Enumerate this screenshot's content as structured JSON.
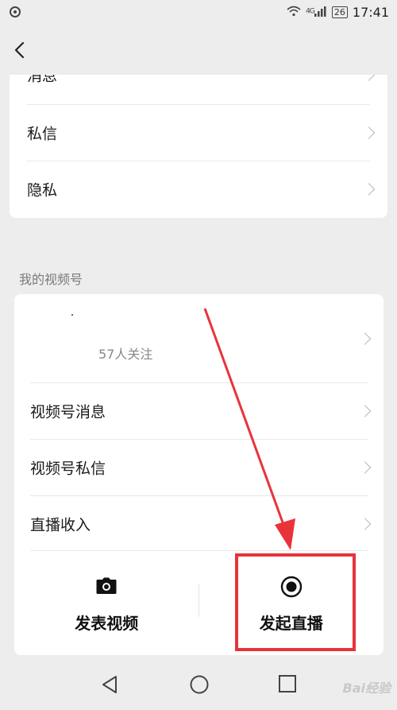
{
  "status_bar": {
    "network": "4G",
    "battery": "26",
    "time": "17:41"
  },
  "settings_list": [
    {
      "label": "消息"
    },
    {
      "label": "私信"
    },
    {
      "label": "隐私"
    }
  ],
  "channels": {
    "section_title": "我的视频号",
    "followers": "57人关注",
    "items": [
      {
        "label": "视频号消息"
      },
      {
        "label": "视频号私信"
      },
      {
        "label": "直播收入"
      }
    ],
    "actions": {
      "post_video": "发表视频",
      "start_live": "发起直播"
    }
  },
  "watermark": "Bai经验",
  "colors": {
    "annotation": "#e8333b",
    "background": "#ededed",
    "card": "#ffffff"
  }
}
